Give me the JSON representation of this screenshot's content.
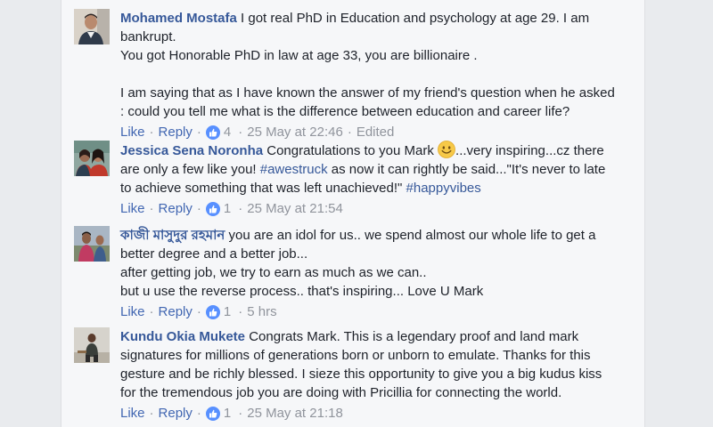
{
  "comments": [
    {
      "author": "Mohamed Mostafa",
      "lines": [
        "I got real PhD in Education and psychology at age 29. I am",
        "bankrupt.",
        "You got Honorable PhD in law at age 33, you are billionaire .",
        "",
        "I am saying that as I have known the answer of my friend's question when he asked",
        ": could you tell me what is the difference between education and career life?"
      ],
      "like_label": "Like",
      "reply_label": "Reply",
      "reaction_count": "4",
      "timestamp": "25 May at 22:46",
      "edited_label": "Edited"
    },
    {
      "author": "Jessica Sena Noronha",
      "text_a": "Congratulations to you Mark",
      "emoji": "smile-emoji",
      "text_b": "...very inspiring...cz there",
      "line2_a": "are only a few like you!",
      "hashtag1": "#awestruck",
      "line2_b": "as now it can rightly be said...\"It's never to late",
      "line3_a": "to achieve something that was left unachieved!\"",
      "hashtag2": "#happyvibes",
      "like_label": "Like",
      "reply_label": "Reply",
      "reaction_count": "1",
      "timestamp": "25 May at 21:54"
    },
    {
      "author": "কাজী মাসুদুর রহমান",
      "lines": [
        "you are an idol for us.. we spend almost our whole life to get a",
        "better degree and a better job...",
        "after getting job, we try to earn as much as we can..",
        "but u use the reverse process.. that's inspiring... Love U Mark"
      ],
      "like_label": "Like",
      "reply_label": "Reply",
      "reaction_count": "1",
      "timestamp": "5 hrs"
    },
    {
      "author": "Kundu Okia Mukete",
      "lines": [
        "Congrats Mark. This is a legendary proof and land mark",
        "signatures for millions of generations born or unborn to emulate. Thanks for this",
        "gesture and be richly blessed. I sieze this opportunity to give you a big kudus kiss",
        "for the tremendous job you are doing with Pricillia for connecting the world."
      ],
      "like_label": "Like",
      "reply_label": "Reply",
      "reaction_count": "1",
      "timestamp": "25 May at 21:18"
    }
  ],
  "colors": {
    "author": "#365899",
    "action_link": "#4267b2",
    "meta": "#90949c",
    "like_badge": "#5890ff"
  }
}
